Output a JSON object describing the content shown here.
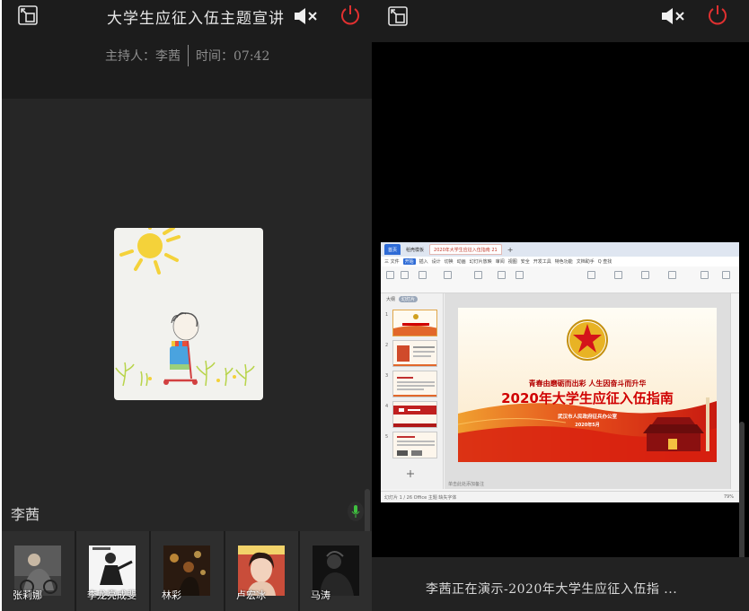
{
  "left_panel": {
    "title": "大学生应征入伍主题宣讲",
    "host_label": "主持人：李茜",
    "time_label": "时间：07:42",
    "speaker_name": "李茜",
    "participants": [
      {
        "name": "张莉娜"
      },
      {
        "name": "李龙亮成斐"
      },
      {
        "name": "林彩"
      },
      {
        "name": "卢宏冰"
      },
      {
        "name": "马涛"
      }
    ]
  },
  "right_panel": {
    "footer_text": "李茜正在演示-2020年大学生应征入伍指 ...",
    "wps": {
      "tabs": {
        "home": "首页",
        "templates": "稻壳模板",
        "doc": "2020年大学生应征入伍指南 21",
        "plus": "+"
      },
      "menu": [
        "三 文件",
        "开始",
        "插入",
        "设计",
        "切换",
        "动画",
        "幻灯片放映",
        "审阅",
        "视图",
        "安全",
        "开发工具",
        "特色功能",
        "文档助手",
        "Q 查找"
      ],
      "menu_active_index": 1,
      "panel_tabs": {
        "outline": "大纲",
        "slides": "幻灯片"
      },
      "slide_numbers": [
        "1",
        "2",
        "3",
        "4",
        "5"
      ],
      "status_left": "幻灯片 1 / 26    Office 主题    缺失字体",
      "status_right": "79%",
      "notes_placeholder": "单击此处添加备注",
      "slide": {
        "subtitle": "青春由磨砺而出彩  人生因奋斗而升华",
        "title": "2020年大学生应征入伍指南",
        "org": "武汉市人民政府征兵办公室",
        "date": "2020年5月"
      }
    }
  },
  "colors": {
    "power_icon": "#e03030",
    "slide_red": "#d00000",
    "wps_blue": "#2e6bd6",
    "mic_green": "#3fbf3f"
  },
  "icons": {
    "exit_fullscreen": "exit-fullscreen-icon",
    "mute": "speaker-mute-icon",
    "power": "power-icon",
    "mic": "microphone-icon"
  }
}
